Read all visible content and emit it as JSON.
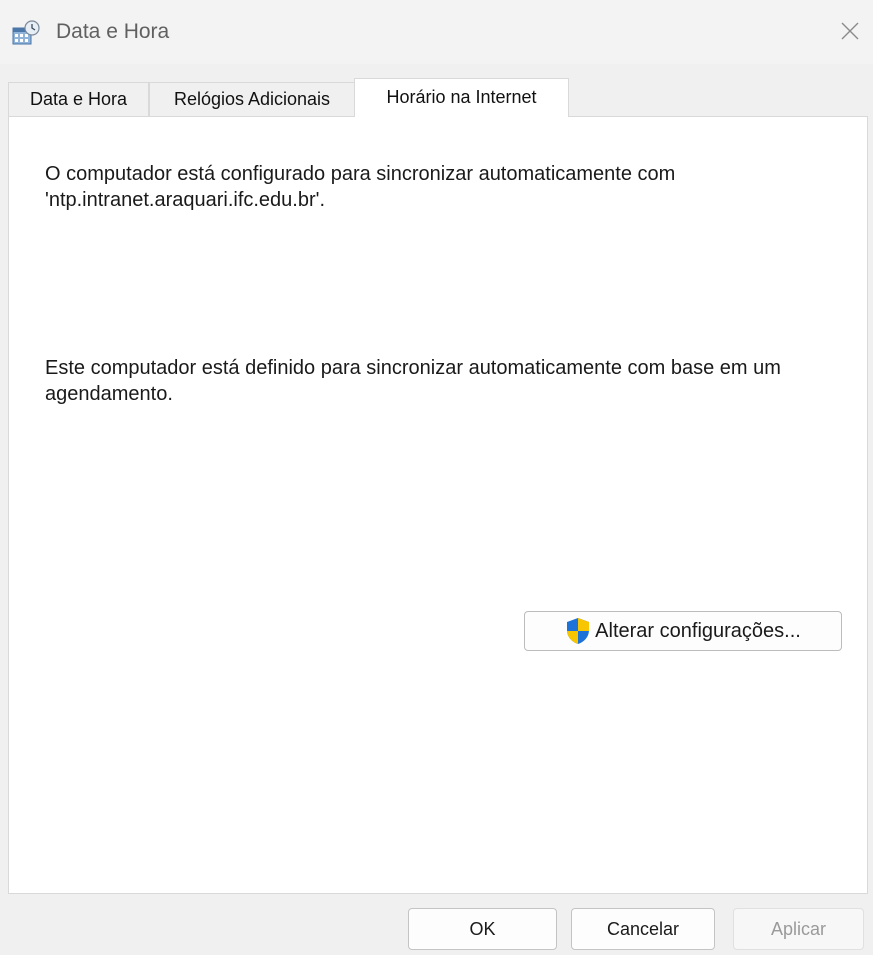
{
  "window": {
    "title": "Data e Hora",
    "title_icon": "date-time-calendar-icon",
    "close_icon": "close-icon"
  },
  "tabs": [
    {
      "label": "Data e Hora",
      "active": false
    },
    {
      "label": "Relógios Adicionais",
      "active": false
    },
    {
      "label": "Horário na Internet",
      "active": true
    }
  ],
  "panel": {
    "sync_server_text": "O computador está configurado para sincronizar automaticamente com 'ntp.intranet.araquari.ifc.edu.br'.",
    "schedule_text": "Este computador está definido para sincronizar automaticamente com base em um agendamento.",
    "change_settings_label": "Alterar configurações...",
    "change_settings_icon": "uac-shield-icon"
  },
  "footer": {
    "ok_label": "OK",
    "cancel_label": "Cancelar",
    "apply_label": "Aplicar",
    "apply_enabled": false
  },
  "colors": {
    "shield_blue": "#1e73d8",
    "shield_yellow": "#f7c600"
  }
}
